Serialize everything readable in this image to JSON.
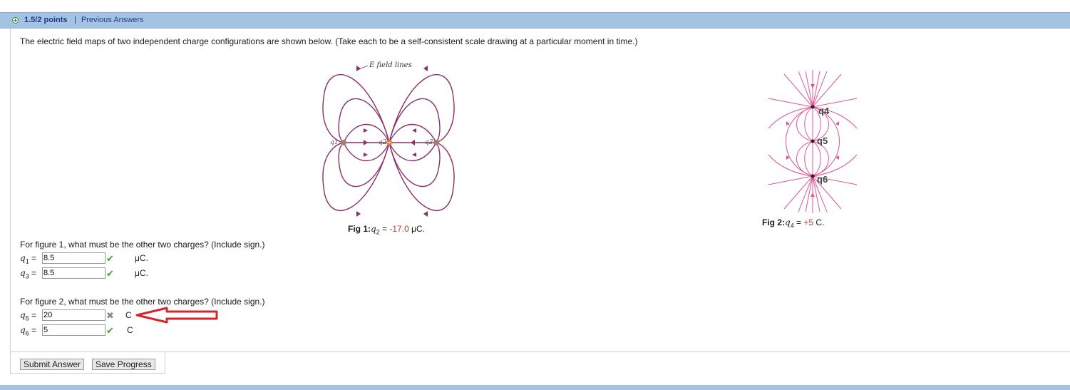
{
  "header": {
    "points": "1.5/2 points",
    "separator": "|",
    "previous": "Previous Answers"
  },
  "question": {
    "intro": "The electric field maps of two independent charge configurations are shown below. (Take each to be a self-consistent scale drawing at a particular moment in time.)"
  },
  "fig1": {
    "label_lines": "E field lines",
    "charges": [
      "q1",
      "q2",
      "q3"
    ],
    "caption_prefix": "Fig 1:",
    "caption_var": "q",
    "caption_sub": "2",
    "caption_eq": " = ",
    "caption_value": "-17.0",
    "caption_unit": " μC."
  },
  "fig2": {
    "charges": [
      "q4",
      "q5",
      "q6"
    ],
    "caption_prefix": "Fig 2:",
    "caption_var": "q",
    "caption_sub": "4",
    "caption_eq": " = ",
    "caption_value": "+5",
    "caption_unit": " C."
  },
  "part1": {
    "prompt": "For figure 1, what must be the other two charges? (Include sign.)",
    "rows": [
      {
        "var": "q",
        "sub": "1",
        "eq": " =",
        "value": "8.5",
        "status": "correct",
        "unit": "μC."
      },
      {
        "var": "q",
        "sub": "3",
        "eq": " =",
        "value": "8.5",
        "status": "correct",
        "unit": "μC."
      }
    ]
  },
  "part2": {
    "prompt": "For figure 2, what must be the other two charges? (Include sign.)",
    "rows": [
      {
        "var": "q",
        "sub": "5",
        "eq": " =",
        "value": "20",
        "status": "incorrect",
        "unit": "C"
      },
      {
        "var": "q",
        "sub": "6",
        "eq": " =",
        "value": "5",
        "status": "correct",
        "unit": "C"
      }
    ]
  },
  "buttons": {
    "submit": "Submit Answer",
    "save": "Save Progress"
  },
  "colors": {
    "header": "#a4c3e3",
    "fig1_lines": "#8a2f6a",
    "fig2_lines": "#e0559a",
    "arrow": "#d9232d",
    "correct": "#4a9a3a"
  }
}
